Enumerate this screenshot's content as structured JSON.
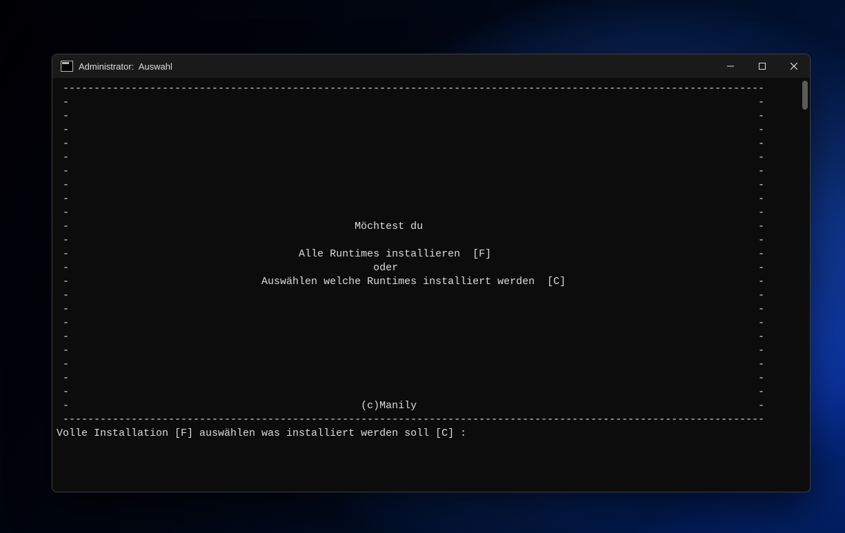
{
  "window": {
    "title": "Administrator:  Auswahl"
  },
  "terminal": {
    "border_top": " -----------------------------------------------------------------------------------------------------------------",
    "border_empty": " -                                                                                                               -",
    "line_q": " -                                              Möchtest du                                                      -",
    "line_full": " -                                     Alle Runtimes installieren  [F]                                           -",
    "line_or": " -                                                 oder                                                          -",
    "line_custom": " -                               Auswählen welche Runtimes installiert werden  [C]                               -",
    "line_copyright": " -                                               (c)Manily                                                       -",
    "border_bottom": " -----------------------------------------------------------------------------------------------------------------",
    "prompt": "Volle Installation [F] auswählen was installiert werden soll [C] :"
  }
}
